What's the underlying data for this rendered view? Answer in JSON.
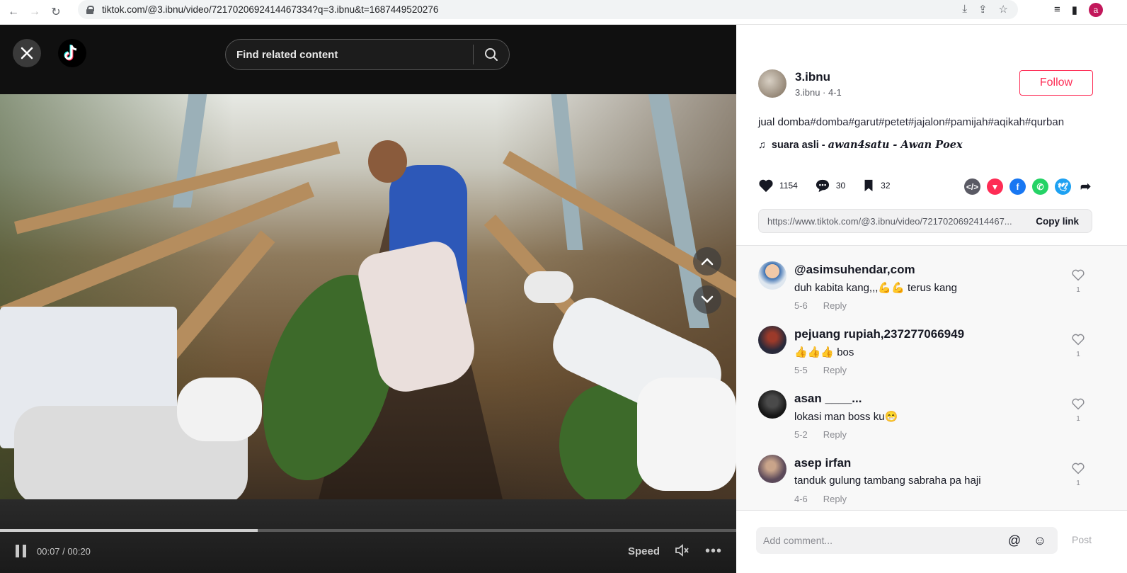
{
  "browser": {
    "url": "tiktok.com/@3.ibnu/video/7217020692414467334?q=3.ibnu&t=1687449520276",
    "profile_initial": "a"
  },
  "video": {
    "search_placeholder": "Find related content",
    "current_time": "00:07",
    "duration": "00:20",
    "time_display": "00:07 / 00:20",
    "progress": 0.35,
    "speed_label": "Speed"
  },
  "author": {
    "username": "3.ibnu",
    "subline": "3.ibnu · 4-1",
    "follow_label": "Follow"
  },
  "description": {
    "text": "jual domba",
    "tags": [
      "#domba",
      "#garut",
      "#petet",
      "#jajalon",
      "#pamijah",
      "#aqikah",
      "#qurban"
    ]
  },
  "music": {
    "label": "suara asli - ",
    "artist": "𝒂𝒘𝒂𝒏4𝒔𝒂𝒕𝒖 - 𝑨𝒘𝒂𝒏 𝑷𝒐𝒆𝒙"
  },
  "stats": {
    "likes": "1154",
    "comments": "30",
    "saves": "32"
  },
  "share": {
    "link": "https://www.tiktok.com/@3.ibnu/video/7217020692414467...",
    "copy_label": "Copy link",
    "colors": {
      "embed": "#5a5a64",
      "send": "#fe2c55",
      "facebook": "#1877f2",
      "whatsapp": "#25d366",
      "twitter": "#1da1f2"
    }
  },
  "comments": [
    {
      "user": "@asimsuhendar,com",
      "text": "duh kabita kang,,,💪💪 terus kang",
      "date": "5-6",
      "reply": "Reply",
      "likes": "1"
    },
    {
      "user": "pejuang rupiah,237277066949",
      "text": "👍👍👍 bos",
      "date": "5-5",
      "reply": "Reply",
      "likes": "1"
    },
    {
      "user": "asan ____...",
      "text": "lokasi man boss ku😁",
      "date": "5-2",
      "reply": "Reply",
      "likes": "1"
    },
    {
      "user": "asep irfan",
      "text": "tanduk gulung tambang sabraha pa haji",
      "date": "4-6",
      "reply": "Reply",
      "likes": "1"
    }
  ],
  "comment_bar": {
    "placeholder": "Add comment...",
    "post_label": "Post"
  }
}
